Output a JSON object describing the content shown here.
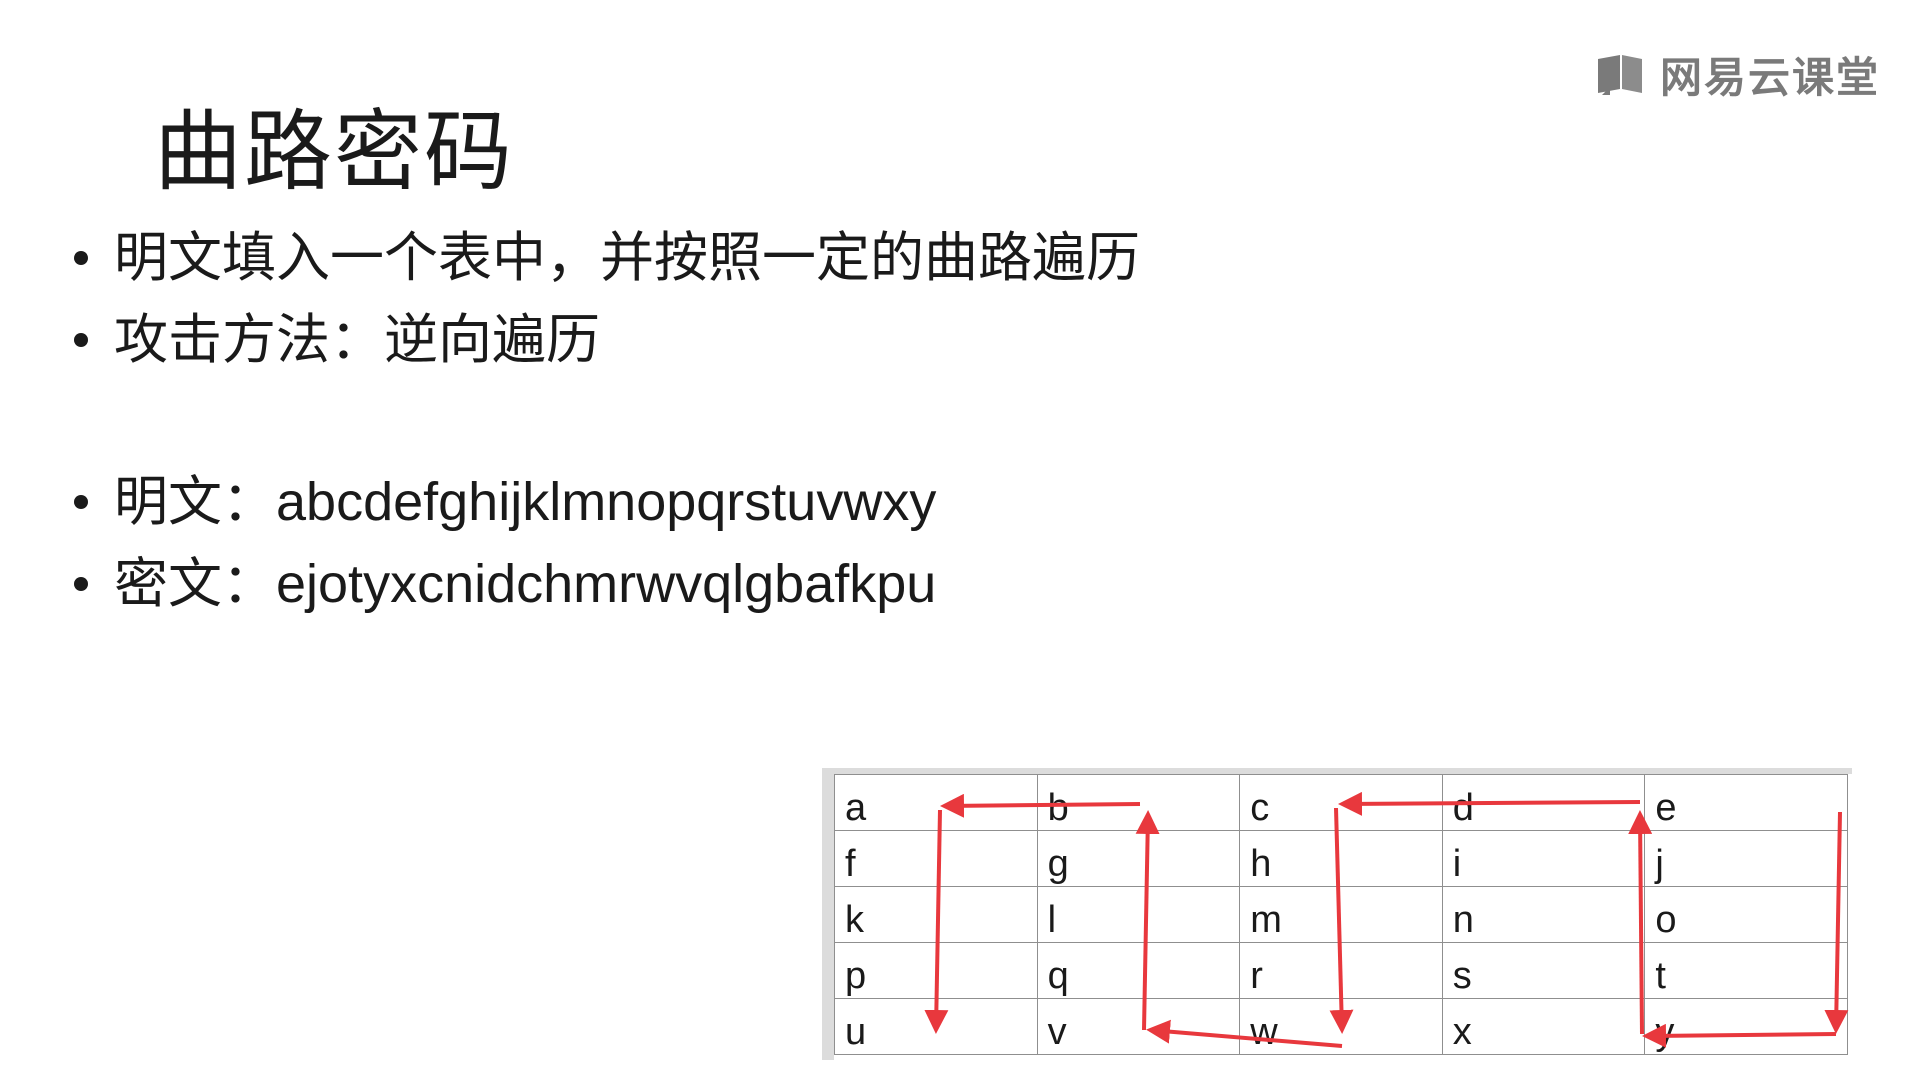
{
  "logo": {
    "text": "网易云课堂",
    "icon": "book-icon",
    "color": "#7a7a7a"
  },
  "title": "曲路密码",
  "bullets": [
    {
      "text": "明文填入一个表中，并按照一定的曲路遍历"
    },
    {
      "text": "攻击方法：逆向遍历"
    },
    {
      "label": "明文：",
      "value": "abcdefghijklmnopqrstuvwxy"
    },
    {
      "label": "密文：",
      "value": "ejotyxcnidchmrwvqlgbafkpu"
    }
  ],
  "grid": {
    "rows": [
      [
        "a",
        "b",
        "c",
        "d",
        "e"
      ],
      [
        "f",
        "g",
        "h",
        "i",
        "j"
      ],
      [
        "k",
        "l",
        "m",
        "n",
        "o"
      ],
      [
        "p",
        "q",
        "r",
        "s",
        "t"
      ],
      [
        "u",
        "v",
        "w",
        "x",
        "y"
      ]
    ],
    "arrow_color": "#e8383d"
  }
}
